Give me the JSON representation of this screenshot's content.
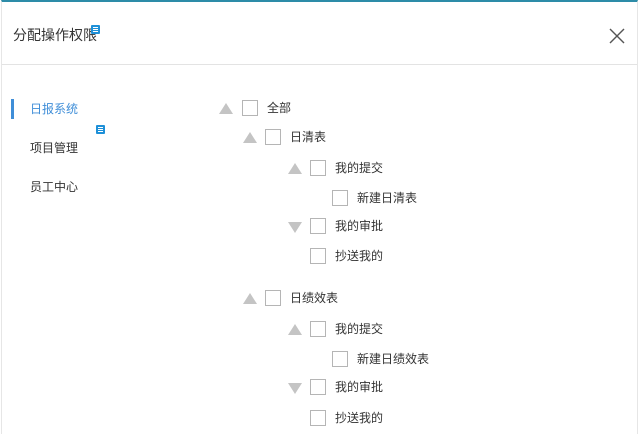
{
  "dialog": {
    "title": "分配操作权限",
    "close_icon": "close-icon"
  },
  "sidebar": {
    "items": [
      {
        "label": "日报系统",
        "active": true
      },
      {
        "label": "项目管理",
        "active": false
      },
      {
        "label": "员工中心",
        "active": false
      }
    ]
  },
  "tree": {
    "root": {
      "label": "全部",
      "checked": false,
      "expanded": true
    },
    "groups": [
      {
        "label": "日清表",
        "checked": false,
        "expanded": true,
        "children": [
          {
            "label": "我的提交",
            "checked": false,
            "expanded": true,
            "children": [
              {
                "label": "新建日清表",
                "checked": false
              }
            ]
          },
          {
            "label": "我的审批",
            "checked": false,
            "expanded": false
          },
          {
            "label": "抄送我的",
            "checked": false
          }
        ]
      },
      {
        "label": "日绩效表",
        "checked": false,
        "expanded": true,
        "children": [
          {
            "label": "我的提交",
            "checked": false,
            "expanded": true,
            "children": [
              {
                "label": "新建日绩效表",
                "checked": false
              }
            ]
          },
          {
            "label": "我的审批",
            "checked": false,
            "expanded": false
          },
          {
            "label": "抄送我的",
            "checked": false
          }
        ]
      }
    ]
  },
  "colors": {
    "accent": "#3f8ed8",
    "top_border": "#2d8ca8",
    "doc_badge": "#1e90d8",
    "arrow": "#c4c4c4"
  }
}
